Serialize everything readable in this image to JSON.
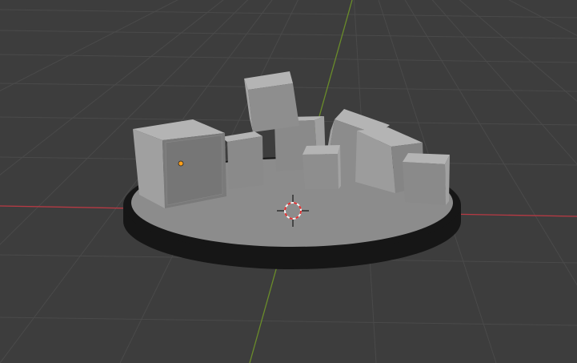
{
  "viewport": {
    "mode": "3D Viewport",
    "shading": "solid"
  },
  "colors": {
    "background": "#3d3d3d",
    "grid_line": "#4a4a4a",
    "x_axis": "#b83a44",
    "y_axis": "#6a8c2a",
    "plate_top": "#8c8c8c",
    "plate_side": "#161616",
    "cube_front": "#7a7a7a",
    "cube_top": "#b4b4b4",
    "cube_side": "#9a9a9a",
    "origin_point": "#ff9f1a",
    "cursor_ring_red": "#e03030",
    "cursor_ring_white": "#f0f0f0"
  },
  "scene": {
    "objects": [
      "base-plate",
      "cube",
      "cube",
      "cube",
      "cube",
      "cube",
      "cube",
      "cube",
      "cube"
    ],
    "active_object": "cube",
    "cursor": "3d-cursor"
  }
}
